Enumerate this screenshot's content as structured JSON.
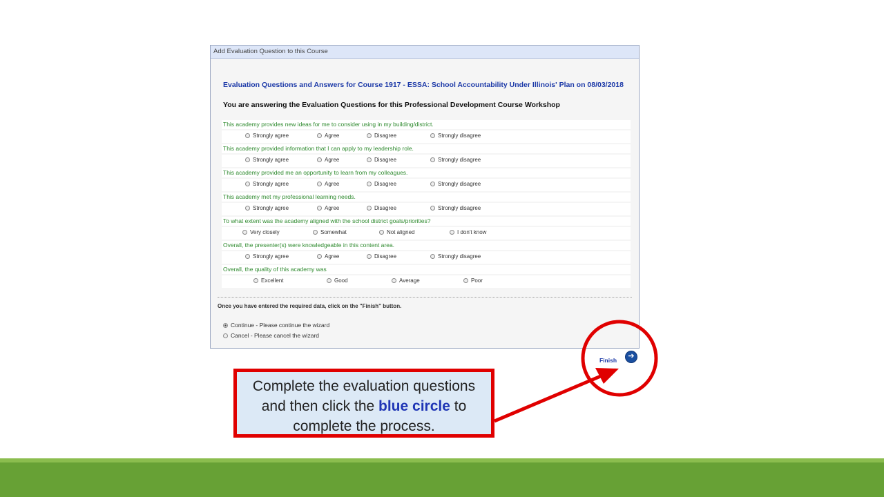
{
  "panel": {
    "header": "Add Evaluation Question to this Course",
    "course_title": "Evaluation Questions and Answers for Course 1917 - ESSA: School Accountability Under Illinois' Plan on 08/03/2018",
    "instructions": "You are answering the Evaluation Questions for this Professional Development Course Workshop"
  },
  "questions": [
    {
      "text": "This academy provides new ideas for me to consider using in my building/district.",
      "options": [
        "Strongly agree",
        "Agree",
        "Disagree",
        "Strongly disagree"
      ]
    },
    {
      "text": "This academy provided information that I can apply to my leadership role.",
      "options": [
        "Strongly agree",
        "Agree",
        "Disagree",
        "Strongly disagree"
      ]
    },
    {
      "text": "This academy provided me an opportunity to learn from my colleagues.",
      "options": [
        "Strongly agree",
        "Agree",
        "Disagree",
        "Strongly disagree"
      ]
    },
    {
      "text": "This academy met my professional learning needs.",
      "options": [
        "Strongly agree",
        "Agree",
        "Disagree",
        "Strongly disagree"
      ]
    },
    {
      "text": "To what extent was the academy aligned with the school district goals/priorities?",
      "options": [
        "Very closely",
        "Somewhat",
        "Not aligned",
        "I don't know"
      ]
    },
    {
      "text": "Overall, the presenter(s) were knowledgeable in this content area.",
      "options": [
        "Strongly agree",
        "Agree",
        "Disagree",
        "Strongly disagree"
      ]
    },
    {
      "text": "Overall, the quality of this academy was",
      "options": [
        "Excellent",
        "Good",
        "Average",
        "Poor"
      ]
    }
  ],
  "wizard": {
    "note": "Once you have entered the required data, click on the \"Finish\" button.",
    "continue_label": "Continue - Please continue the wizard",
    "cancel_label": "Cancel - Please cancel the wizard",
    "finish_label": "Finish"
  },
  "callout": {
    "line1": "Complete the evaluation questions",
    "line2_before": "and then click the ",
    "line2_highlight": "blue circle",
    "line2_after": " to",
    "line3": "complete the process."
  },
  "colors": {
    "question_text": "#2e8a2e",
    "title_blue": "#1d3aa8",
    "callout_border": "#e00000",
    "footer_green": "#67a135"
  }
}
